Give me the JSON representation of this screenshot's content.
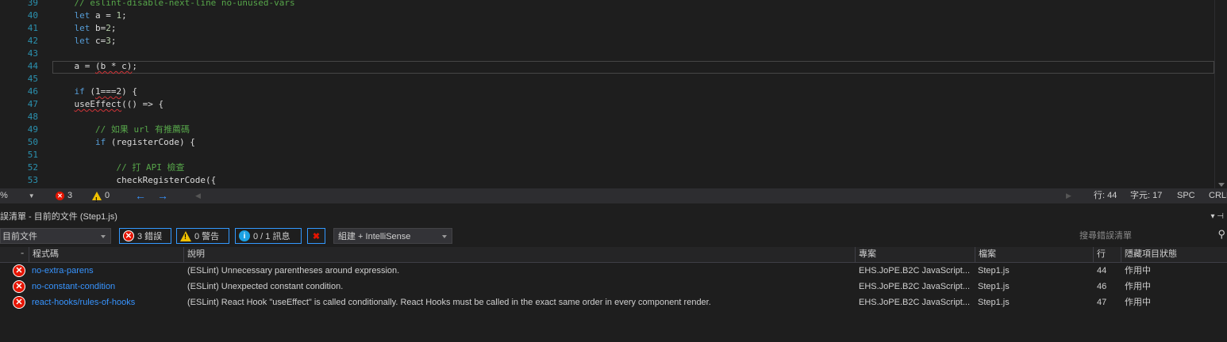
{
  "editor": {
    "lines": [
      {
        "n": "39",
        "tokens": [
          {
            "t": "    ",
            "c": ""
          },
          {
            "t": "// eslint-disable-next-line no-unused-vars",
            "c": "cm"
          }
        ]
      },
      {
        "n": "40",
        "tokens": [
          {
            "t": "    ",
            "c": ""
          },
          {
            "t": "let",
            "c": "kw"
          },
          {
            "t": " a = ",
            "c": ""
          },
          {
            "t": "1",
            "c": "nm"
          },
          {
            "t": ";",
            "c": ""
          }
        ]
      },
      {
        "n": "41",
        "tokens": [
          {
            "t": "    ",
            "c": ""
          },
          {
            "t": "let",
            "c": "kw"
          },
          {
            "t": " b=",
            "c": ""
          },
          {
            "t": "2",
            "c": "nm"
          },
          {
            "t": ";",
            "c": ""
          }
        ]
      },
      {
        "n": "42",
        "tokens": [
          {
            "t": "    ",
            "c": ""
          },
          {
            "t": "let",
            "c": "kw"
          },
          {
            "t": " c=",
            "c": ""
          },
          {
            "t": "3",
            "c": "nm"
          },
          {
            "t": ";",
            "c": ""
          }
        ]
      },
      {
        "n": "43",
        "tokens": []
      },
      {
        "n": "44",
        "tokens": [
          {
            "t": "    a = ",
            "c": ""
          },
          {
            "t": "(b * c)",
            "c": "sq"
          },
          {
            "t": ";",
            "c": ""
          }
        ]
      },
      {
        "n": "45",
        "tokens": []
      },
      {
        "n": "46",
        "tokens": [
          {
            "t": "    ",
            "c": ""
          },
          {
            "t": "if",
            "c": "kw"
          },
          {
            "t": " (",
            "c": ""
          },
          {
            "t": "1===2",
            "c": "sq"
          },
          {
            "t": ") {",
            "c": ""
          }
        ]
      },
      {
        "n": "47",
        "tokens": [
          {
            "t": "    ",
            "c": ""
          },
          {
            "t": "useEffect",
            "c": "sq"
          },
          {
            "t": "(() => {",
            "c": ""
          }
        ]
      },
      {
        "n": "48",
        "tokens": []
      },
      {
        "n": "49",
        "tokens": [
          {
            "t": "        ",
            "c": ""
          },
          {
            "t": "// 如果 url 有推薦碼",
            "c": "cm"
          }
        ]
      },
      {
        "n": "50",
        "tokens": [
          {
            "t": "        ",
            "c": ""
          },
          {
            "t": "if",
            "c": "kw"
          },
          {
            "t": " (registerCode) {",
            "c": ""
          }
        ]
      },
      {
        "n": "51",
        "tokens": []
      },
      {
        "n": "52",
        "tokens": [
          {
            "t": "            ",
            "c": ""
          },
          {
            "t": "// 打 API 檢查",
            "c": "cm"
          }
        ]
      },
      {
        "n": "53",
        "tokens": [
          {
            "t": "            checkRegisterCode({",
            "c": ""
          }
        ]
      }
    ]
  },
  "status_bar": {
    "zoom": "%",
    "error_count": "3",
    "warning_count": "0",
    "line": "行: 44",
    "col": "字元: 17",
    "spc": "SPC",
    "eol": "CRLF"
  },
  "panel": {
    "title": "誤清單 - 目前的文件 (Step1.js)",
    "pin": "▾ ⊣",
    "scope": "目前文件",
    "errors_label": "3 錯誤",
    "warnings_label": "0 警告",
    "messages_label": "0 / 1 訊息",
    "build_filter": "組建 + IntelliSense",
    "search_placeholder": "搜尋錯誤清單"
  },
  "grid": {
    "headers": {
      "code": "程式碼",
      "description": "說明",
      "project": "專案",
      "file": "檔案",
      "line": "行",
      "suppression": "隱藏項目狀態"
    },
    "rows": [
      {
        "code": "no-extra-parens",
        "description": "(ESLint) Unnecessary parentheses around expression.",
        "project": "EHS.JoPE.B2C JavaScript...",
        "file": "Step1.js",
        "line": "44",
        "state": "作用中"
      },
      {
        "code": "no-constant-condition",
        "description": "(ESLint) Unexpected constant condition.",
        "project": "EHS.JoPE.B2C JavaScript...",
        "file": "Step1.js",
        "line": "46",
        "state": "作用中"
      },
      {
        "code": "react-hooks/rules-of-hooks",
        "description": "(ESLint) React Hook \"useEffect\" is called conditionally. React Hooks must be called in the exact same order in every component render.",
        "project": "EHS.JoPE.B2C JavaScript...",
        "file": "Step1.js",
        "line": "47",
        "state": "作用中"
      }
    ]
  },
  "colors": {
    "error_red": "#e51400",
    "warning_yellow": "#f0c000",
    "link_blue": "#3794ff",
    "comment_green": "#57a64a",
    "keyword_blue": "#569cd6"
  }
}
